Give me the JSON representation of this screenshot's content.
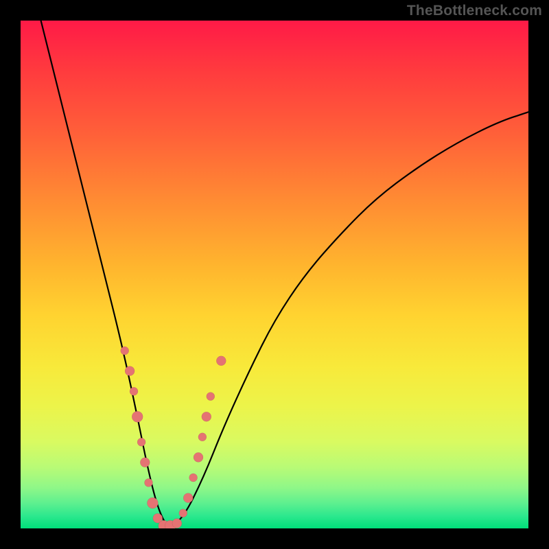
{
  "watermark_text": "TheBottleneck.com",
  "chart_data": {
    "type": "line",
    "title": "",
    "xlabel": "",
    "ylabel": "",
    "xlim": [
      0,
      100
    ],
    "ylim": [
      0,
      100
    ],
    "legend": false,
    "gradient_colors_top_to_bottom": [
      "#ff1a47",
      "#ffd330",
      "#00e07a"
    ],
    "series": [
      {
        "name": "bottleneck-curve",
        "description": "V-shaped black curve; left branch steep and nearly linear, right branch rises concavely toward upper-right",
        "x": [
          4,
          8,
          12,
          16,
          20,
          23,
          25,
          27,
          29,
          32,
          36,
          40,
          45,
          50,
          56,
          63,
          70,
          78,
          86,
          94,
          100
        ],
        "y": [
          100,
          84,
          68,
          52,
          36,
          22,
          12,
          4,
          0,
          2,
          10,
          20,
          31,
          41,
          50,
          58,
          65,
          71,
          76,
          80,
          82
        ]
      }
    ],
    "scatter_points": {
      "name": "highlighted-points",
      "color": "#e57373",
      "description": "Salmon-colored dots clustered near the valley and lower branches of the curve",
      "points": [
        {
          "x": 20.5,
          "y": 35,
          "r": 6
        },
        {
          "x": 21.5,
          "y": 31,
          "r": 7
        },
        {
          "x": 22.3,
          "y": 27,
          "r": 6
        },
        {
          "x": 23.0,
          "y": 22,
          "r": 8
        },
        {
          "x": 23.8,
          "y": 17,
          "r": 6
        },
        {
          "x": 24.5,
          "y": 13,
          "r": 7
        },
        {
          "x": 25.2,
          "y": 9,
          "r": 6
        },
        {
          "x": 26.0,
          "y": 5,
          "r": 8
        },
        {
          "x": 27.0,
          "y": 2,
          "r": 7
        },
        {
          "x": 28.2,
          "y": 0.5,
          "r": 8
        },
        {
          "x": 29.5,
          "y": 0.5,
          "r": 8
        },
        {
          "x": 30.8,
          "y": 1,
          "r": 7
        },
        {
          "x": 32.0,
          "y": 3,
          "r": 6
        },
        {
          "x": 33.0,
          "y": 6,
          "r": 7
        },
        {
          "x": 34.0,
          "y": 10,
          "r": 6
        },
        {
          "x": 35.0,
          "y": 14,
          "r": 7
        },
        {
          "x": 35.8,
          "y": 18,
          "r": 6
        },
        {
          "x": 36.6,
          "y": 22,
          "r": 7
        },
        {
          "x": 37.4,
          "y": 26,
          "r": 6
        },
        {
          "x": 39.5,
          "y": 33,
          "r": 7
        }
      ]
    }
  }
}
